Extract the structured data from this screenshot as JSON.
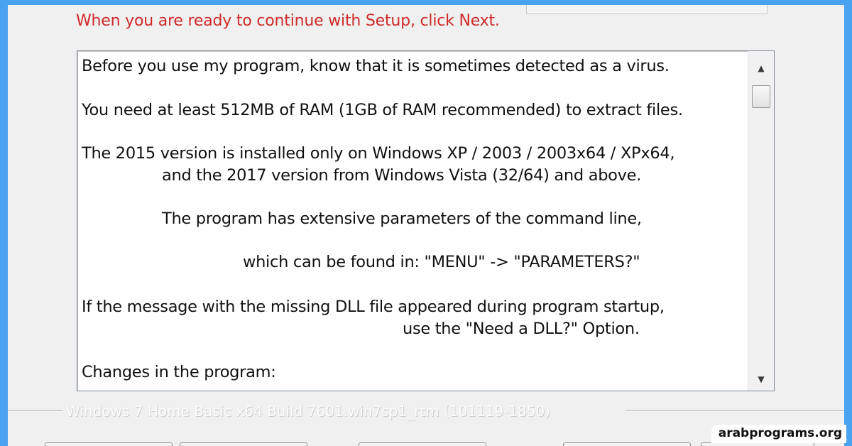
{
  "instruction": "When you are ready to continue with Setup, click Next.",
  "memo": {
    "lines": [
      "Before you use my program, know that it is sometimes detected as a virus.",
      "You need at least 512MB of RAM (1GB of RAM recommended) to extract files.",
      "The 2015 version is installed only on Windows XP / 2003 / 2003x64 / XPx64,",
      "and the 2017 version from Windows Vista (32/64) and above.",
      "The program has extensive parameters of the command line,",
      "which can be found in: \"MENU\" -> \"PARAMETERS?\"",
      "If the message with the missing DLL file appeared during program startup,",
      "use the \"Need a DLL?\" Option.",
      "Changes in the program:"
    ]
  },
  "scrollbar": {
    "up_icon": "scroll-up-arrow-icon",
    "down_icon": "scroll-down-arrow-icon"
  },
  "branding_text": "Windows 7 Home Basic x64 Build 7601.win7sp1_rtm (101119-1850)",
  "watermark": "arabprograms.org",
  "colors": {
    "frame": "#4aa3f0",
    "instruction": "#d02a2a",
    "dialog_bg": "#f0f0f0"
  }
}
